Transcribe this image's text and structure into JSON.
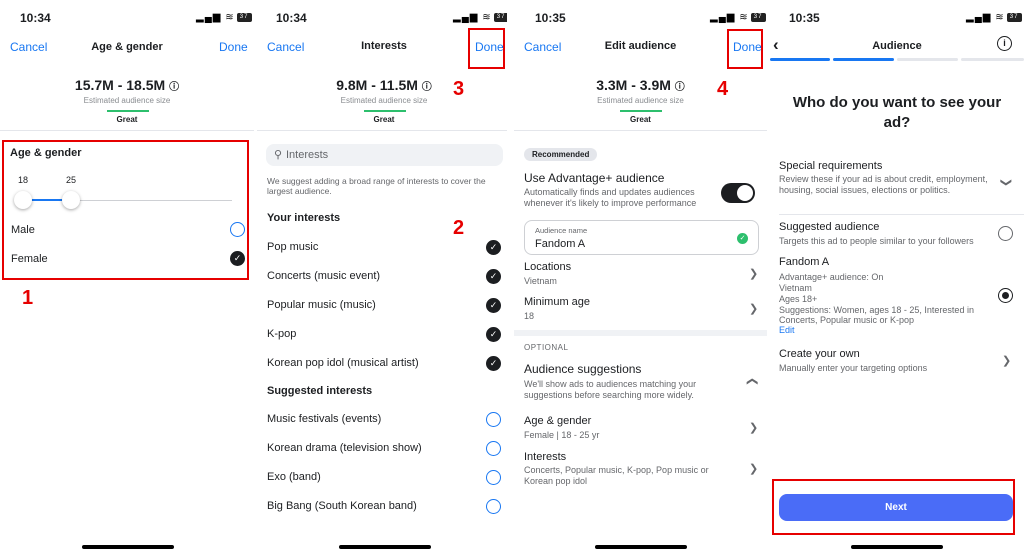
{
  "colors": {
    "accent": "#1877f2",
    "annotation_red": "#e60000",
    "success_green": "#2dbf6d",
    "next_button": "#4a6cf7"
  },
  "annotations": [
    "1",
    "2",
    "3",
    "4"
  ],
  "panel1": {
    "time": "10:34",
    "cancel": "Cancel",
    "title": "Age & gender",
    "done": "Done",
    "audience_size": "15.7M - 18.5M",
    "audience_size_label": "Estimated audience size",
    "rating": "Great",
    "section_title": "Age & gender",
    "age_min": "18",
    "age_max": "25",
    "options": [
      {
        "label": "Male",
        "selected": false
      },
      {
        "label": "Female",
        "selected": true
      }
    ]
  },
  "panel2": {
    "time": "10:34",
    "cancel": "Cancel",
    "title": "Interests",
    "done": "Done",
    "audience_size": "9.8M - 11.5M",
    "audience_size_label": "Estimated audience size",
    "rating": "Great",
    "search_placeholder": "Interests",
    "hint": "We suggest adding a broad range of interests to cover the largest audience.",
    "your_interests_title": "Your interests",
    "your_interests": [
      "Pop music",
      "Concerts (music event)",
      "Popular music (music)",
      "K-pop",
      "Korean pop idol (musical artist)"
    ],
    "suggested_title": "Suggested interests",
    "suggested": [
      "Music festivals (events)",
      "Korean drama (television show)",
      "Exo (band)",
      "Big Bang (South Korean band)"
    ]
  },
  "panel3": {
    "time": "10:35",
    "cancel": "Cancel",
    "title": "Edit audience",
    "done": "Done",
    "audience_size": "3.3M - 3.9M",
    "audience_size_label": "Estimated audience size",
    "rating": "Great",
    "recommended": "Recommended",
    "advantage_title": "Use Advantage+ audience",
    "advantage_desc": "Automatically finds and updates audiences whenever it's likely to improve performance",
    "advantage_enabled": true,
    "audience_name_label": "Audience name",
    "audience_name_value": "Fandom A",
    "locations_label": "Locations",
    "locations_value": "Vietnam",
    "min_age_label": "Minimum age",
    "min_age_value": "18",
    "optional": "OPTIONAL",
    "suggestions_title": "Audience suggestions",
    "suggestions_desc": "We'll show ads to audiences matching your suggestions before searching more widely.",
    "age_gender_label": "Age & gender",
    "age_gender_value": "Female | 18 - 25 yr",
    "interests_label": "Interests",
    "interests_value": "Concerts, Popular music, K-pop, Pop music or Korean pop idol"
  },
  "panel4": {
    "time": "10:35",
    "title": "Audience",
    "heading": "Who do you want to see your ad?",
    "special_title": "Special requirements",
    "special_desc": "Review these if your ad is about credit, employment, housing, social issues, elections or politics.",
    "suggested_title": "Suggested audience",
    "suggested_desc": "Targets this ad to people similar to your followers",
    "fandom_title": "Fandom A",
    "fandom_lines": [
      "Advantage+ audience: On",
      "Vietnam",
      "Ages 18+",
      "Suggestions: Women, ages 18 - 25, Interested in",
      "Concerts, Popular music or K-pop"
    ],
    "fandom_edit": "Edit",
    "create_title": "Create your own",
    "create_desc": "Manually enter your targeting options",
    "next": "Next"
  }
}
